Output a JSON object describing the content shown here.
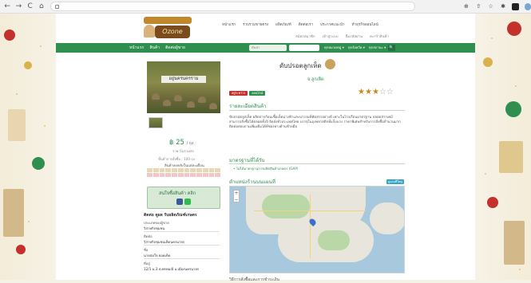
{
  "browser": {
    "url": "",
    "nav": [
      "←",
      "→",
      "C",
      "⌂"
    ],
    "extensions": [
      "zoom-icon",
      "share-icon",
      "star-icon",
      "puzzle-icon",
      "sidebar-icon",
      "profile-icon"
    ]
  },
  "header": {
    "logo_text": "Ozone",
    "top_links": [
      "หน้าแรก",
      "รวบรวมขายตรง",
      "ผลิตภัณฑ์",
      "ติดต่อเรา",
      "ประกาศแนะนำ",
      "ทำธุรกิจออนไลน์"
    ],
    "sub_links": [
      "สมัครสมาชิก",
      "เข้าสู่ระบบ",
      "ลืมรหัสผ่าน",
      "ตะกร้าสินค้า"
    ]
  },
  "nav": {
    "menu": [
      "หน้าแรก",
      "สินค้า",
      "ติดต่อผู้ขาย"
    ],
    "search_placeholder": "ค้นหา",
    "filters": [
      "ทุกหมวดหมู่ ▾",
      "ทุกจังหวัด ▾",
      "ทุกสถานะ ▾"
    ],
    "go": "🔍"
  },
  "product": {
    "image_caption": "อยู่นครนครราม",
    "title": "ดับปรอตลูกเห็ด",
    "subtitle": "จ.ลูกเห็ด",
    "tags": [
      "อยู่ระหว่าง",
      "ออนไลน์"
    ],
    "rating": 3,
    "rating_max": 5,
    "price": "฿ 25",
    "price_unit": "/ ถุง",
    "price_note": "ราคาไม่รวมส่ง",
    "min_order": "ขั้นต่ำการสั่งซื้อ : 100 ถุง",
    "stock_title": "สินค้าคงคลังในแต่ละเดือน",
    "stock_months": [
      "ม.ค.",
      "ก.พ.",
      "มี.ค.",
      "เม.ย.",
      "พ.ค.",
      "มิ.ย.",
      "ก.ค.",
      "ส.ค.",
      "ก.ย.",
      "ต.ค.",
      "พ.ย.",
      "ธ.ค."
    ]
  },
  "sections": {
    "details_title": "รายละเอียดสินค้า",
    "details_text": "ขับปรอตลูกเห็ด ผลิตจากก้อนเชื้อเห็ดนางฟ้าและนางรมที่คัดสรรอย่างดี เพาะในโรงเรือนมาตรฐาน ปลอดสารเคมี สามารถสั่งซื้อได้ตลอดทั้งปี จัดส่งทั่วประเทศไทย บรรจุในถุงพลาสติกที่แข็งแรง ราคาพิเศษสำหรับการสั่งซื้อจำนวนมาก ติดต่อสอบถามเพิ่มเติมได้ที่ช่องทางด้านซ้ายมือ",
    "standard_title": "มาตรฐานที่ได้รับ",
    "standard_item": "ไม่ได้มาตรฐานการผลิตสินค้าเกษตร (GAP)",
    "map_title": "ตำแหน่งร้านบนแผนที่",
    "map_button": "ดูแผนที่ใหญ่",
    "footer_title": "วิธีการสั่งซื้อและการชำระเงิน"
  },
  "sidebar": {
    "contact_button": "สนใจซื้อสินค้า คลิก",
    "contact_title": "ติดต่อ ดูผล รับผลิตภัณฑ์เกษตร",
    "lines": [
      "ประเภทของผู้ขาย",
      "วิสาหกิจชุมชน",
      "ติดต่อ",
      "วิสาหกิจชุมชนเห็ดนครนายก",
      "ชื่อ",
      "นายสมใจ ยอดเห็ด",
      "ที่อยู่",
      "12/1 ม.3 ต.พรหมณี อ.เมืองนครนายก"
    ]
  },
  "colors": {
    "brand_green": "#2f8f4e",
    "star": "#c98a1a",
    "map_water": "#a8c8de"
  }
}
